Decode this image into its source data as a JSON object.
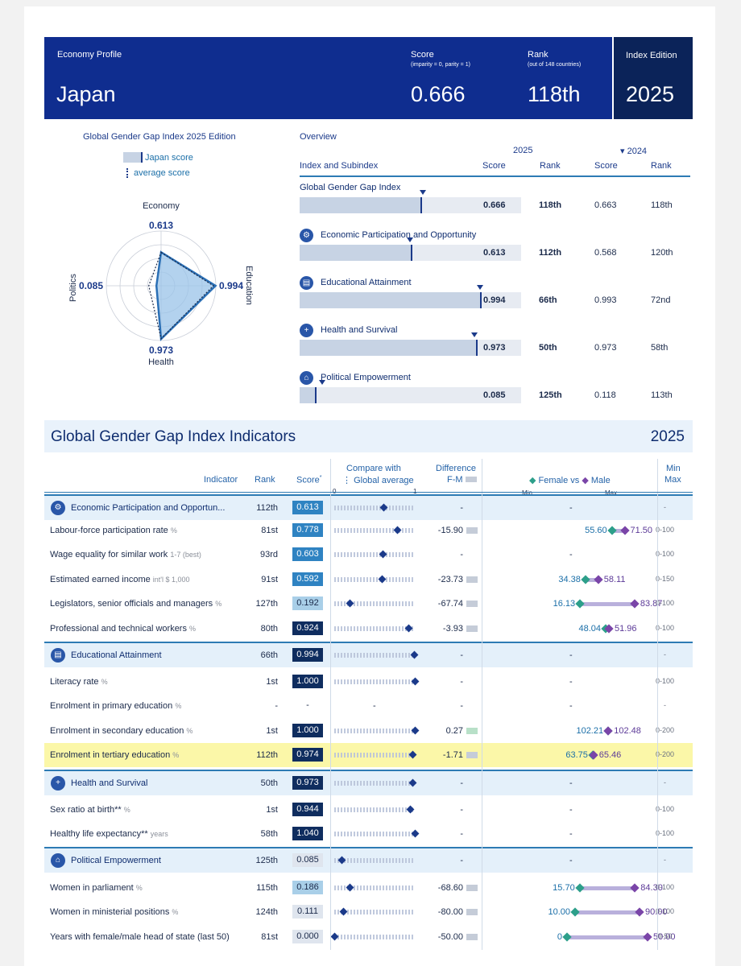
{
  "header": {
    "profile_label": "Economy Profile",
    "country": "Japan",
    "score_label": "Score",
    "score_sub": "(imparity = 0, parity = 1)",
    "score": "0.666",
    "rank_label": "Rank",
    "rank_sub": "(out of 148 countries)",
    "rank": "118th",
    "edition_label": "Index Edition",
    "edition": "2025"
  },
  "radar": {
    "title": "Global Gender Gap Index 2025 Edition",
    "legend_score": "Japan score",
    "legend_avg": "average score",
    "economy_label": "Economy",
    "economy_value": "0.613",
    "education_label": "Education",
    "education_value": "0.994",
    "health_label": "Health",
    "health_value": "0.973",
    "politics_label": "Politics",
    "politics_value": "0.085"
  },
  "overview": {
    "title": "Overview",
    "year_current": "2025",
    "year_prev": "2024",
    "col_index": "Index and Subindex",
    "col_score": "Score",
    "col_rank": "Rank",
    "col_score_prev": "Score",
    "col_rank_prev": "Rank",
    "rows": [
      {
        "name": "Global Gender Gap Index",
        "score": "0.666",
        "rank": "118th",
        "prev_score": "0.663",
        "prev_rank": "118th",
        "value": 0.666,
        "avg": 0.68
      },
      {
        "name": "Economic Participation and Opportunity",
        "score": "0.613",
        "rank": "112th",
        "prev_score": "0.568",
        "prev_rank": "120th",
        "value": 0.613,
        "avg": 0.61
      },
      {
        "name": "Educational Attainment",
        "score": "0.994",
        "rank": "66th",
        "prev_score": "0.993",
        "prev_rank": "72nd",
        "value": 0.994,
        "avg": 0.995
      },
      {
        "name": "Health and Survival",
        "score": "0.973",
        "rank": "50th",
        "prev_score": "0.973",
        "prev_rank": "58th",
        "value": 0.973,
        "avg": 0.965
      },
      {
        "name": "Political Empowerment",
        "score": "0.085",
        "rank": "125th",
        "prev_score": "0.118",
        "prev_rank": "113th",
        "value": 0.085,
        "avg": 0.125
      }
    ]
  },
  "indicators": {
    "title": "Global Gender Gap Index Indicators",
    "year": "2025",
    "col_indicator": "Indicator",
    "col_rank": "Rank",
    "col_score": "Score",
    "col_score_mark": "*",
    "col_compare_1": "Compare with",
    "col_compare_2": "Global average",
    "col_compare_0": "0",
    "col_compare_1v": "1",
    "col_diff_1": "Difference",
    "col_diff_2": "F-M",
    "col_fvm_female": "Female vs",
    "col_fvm_male": "Male",
    "col_min": "Min",
    "col_max": "Max",
    "col_minmax_1": "Min",
    "col_minmax_2": "Max",
    "rows": [
      {
        "type": "sec",
        "name": "Economic Participation and Opportun...",
        "rank": "112th",
        "score": "0.613",
        "diff": "-",
        "f": "",
        "m": "",
        "mm": "-",
        "sv": 0.613,
        "fvm": "-"
      },
      {
        "name": "Labour-force participation rate",
        "unit": "%",
        "rank": "81st",
        "score": "0.778",
        "diff": "-15.90",
        "f": "55.60",
        "m": "71.50",
        "mm": "0-100",
        "sv": 0.778,
        "fn": 55.6,
        "mn": 71.5,
        "max": 100
      },
      {
        "name": "Wage equality for similar work",
        "unit": "1-7 (best)",
        "rank": "93rd",
        "score": "0.603",
        "diff": "-",
        "f": "",
        "m": "",
        "mm": "0-100",
        "sv": 0.603,
        "fvm": "-"
      },
      {
        "name": "Estimated earned income",
        "unit": "int'l $ 1,000",
        "rank": "91st",
        "score": "0.592",
        "diff": "-23.73",
        "f": "34.38",
        "m": "58.11",
        "mm": "0-150",
        "sv": 0.592,
        "fn": 34.38,
        "mn": 58.11,
        "max": 150
      },
      {
        "name": "Legislators, senior officials and managers",
        "unit": "%",
        "rank": "127th",
        "score": "0.192",
        "diff": "-67.74",
        "f": "16.13",
        "m": "83.87",
        "mm": "0-100",
        "sv": 0.192,
        "fn": 16.13,
        "mn": 83.87,
        "max": 100
      },
      {
        "name": "Professional and technical workers",
        "unit": "%",
        "rank": "80th",
        "score": "0.924",
        "diff": "-3.93",
        "f": "48.04",
        "m": "51.96",
        "mm": "0-100",
        "sv": 0.924,
        "fn": 48.04,
        "mn": 51.96,
        "max": 100
      },
      {
        "type": "sec",
        "name": "Educational Attainment",
        "rank": "66th",
        "score": "0.994",
        "diff": "-",
        "f": "",
        "m": "",
        "mm": "-",
        "sv": 0.994,
        "fvm": "-"
      },
      {
        "name": "Literacy rate",
        "unit": "%",
        "rank": "1st",
        "score": "1.000",
        "diff": "-",
        "f": "",
        "m": "",
        "mm": "0-100",
        "sv": 1.0,
        "fvm": "-"
      },
      {
        "name": "Enrolment in primary education",
        "unit": "%",
        "rank": "-",
        "score": "-",
        "diff": "-",
        "f": "",
        "m": "",
        "mm": "-",
        "sv": null,
        "fvm": "-",
        "cmpdash": "-"
      },
      {
        "name": "Enrolment in secondary education",
        "unit": "%",
        "rank": "1st",
        "score": "1.000",
        "diff": "0.27",
        "f": "102.21",
        "m": "102.48",
        "mm": "0-200",
        "sv": 1.0,
        "fn": 102.21,
        "mn": 102.48,
        "max": 200
      },
      {
        "name": "Enrolment in tertiary education",
        "unit": "%",
        "rank": "112th",
        "score": "0.974",
        "diff": "-1.71",
        "f": "63.75",
        "m": "65.46",
        "mm": "0-200",
        "sv": 0.974,
        "fn": 63.75,
        "mn": 65.46,
        "max": 200,
        "hl": true
      },
      {
        "type": "sec",
        "name": "Health and Survival",
        "rank": "50th",
        "score": "0.973",
        "diff": "-",
        "f": "",
        "m": "",
        "mm": "-",
        "sv": 0.973,
        "fvm": "-"
      },
      {
        "name": "Sex ratio at birth**",
        "unit": "%",
        "rank": "1st",
        "score": "0.944",
        "diff": "-",
        "f": "",
        "m": "",
        "mm": "0-100",
        "sv": 0.944,
        "fvm": "-"
      },
      {
        "name": "Healthy life expectancy**",
        "unit": "years",
        "rank": "58th",
        "score": "1.040",
        "diff": "-",
        "f": "",
        "m": "",
        "mm": "0-100",
        "sv": 1.0,
        "fvm": "-"
      },
      {
        "type": "sec",
        "name": "Political Empowerment",
        "rank": "125th",
        "score": "0.085",
        "diff": "-",
        "f": "",
        "m": "",
        "mm": "-",
        "sv": 0.085,
        "fvm": "-"
      },
      {
        "name": "Women in parliament",
        "unit": "%",
        "rank": "115th",
        "score": "0.186",
        "diff": "-68.60",
        "f": "15.70",
        "m": "84.30",
        "mm": "0-100",
        "sv": 0.186,
        "fn": 15.7,
        "mn": 84.3,
        "max": 100
      },
      {
        "name": "Women in ministerial positions",
        "unit": "%",
        "rank": "124th",
        "score": "0.111",
        "diff": "-80.00",
        "f": "10.00",
        "m": "90.00",
        "mm": "0-100",
        "sv": 0.111,
        "fn": 10.0,
        "mn": 90.0,
        "max": 100
      },
      {
        "name": "Years with female/male head of state (last 50)",
        "unit": "",
        "rank": "81st",
        "score": "0.000",
        "diff": "-50.00",
        "f": "0",
        "m": "50.00",
        "mm": "0-50",
        "sv": 0.0,
        "fn": 0,
        "mn": 50,
        "max": 50
      }
    ]
  },
  "colors": {
    "navy": "#0f2d8f",
    "dark": "#0b2359",
    "female": "#2d9f8a",
    "male": "#7a45a8",
    "highlight": "#fbf7a8"
  }
}
